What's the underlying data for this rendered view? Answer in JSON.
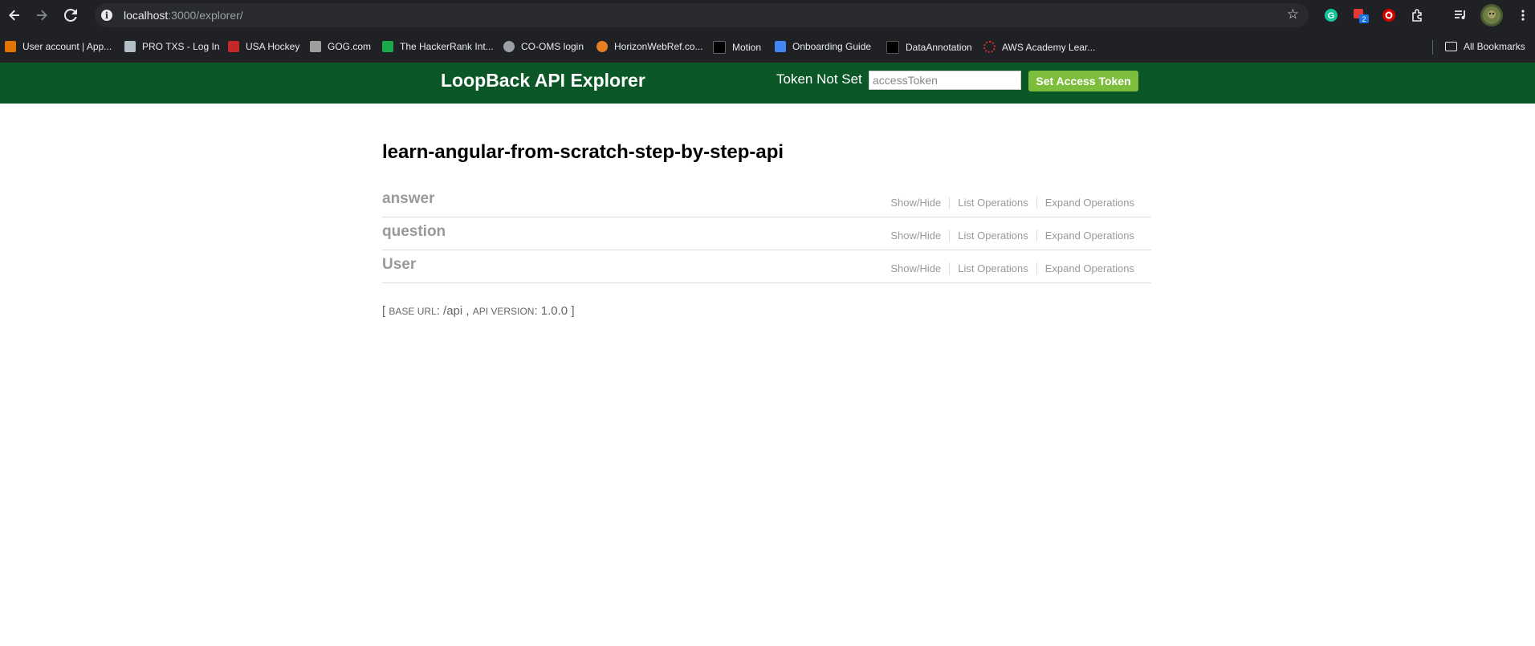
{
  "browser": {
    "url_host": "localhost",
    "url_rest": ":3000/explorer/",
    "extension_badge": "2",
    "all_bookmarks_label": "All Bookmarks",
    "bookmarks": [
      {
        "label": "User account | App...",
        "color": "#e37400"
      },
      {
        "label": "PRO TXS - Log In",
        "color": "#b0bec5"
      },
      {
        "label": "USA Hockey",
        "color": "#c62828"
      },
      {
        "label": "GOG.com",
        "color": "#9e9e9e"
      },
      {
        "label": "The HackerRank Int...",
        "color": "#1ba94c"
      },
      {
        "label": "CO-OMS login",
        "color": "#9aa0a6"
      },
      {
        "label": "HorizonWebRef.co...",
        "color": "#e67e22"
      },
      {
        "label": "Motion",
        "color": "#000000"
      },
      {
        "label": "Onboarding Guide",
        "color": "#4285f4"
      },
      {
        "label": "DataAnnotation",
        "color": "#000000"
      },
      {
        "label": "AWS Academy Lear...",
        "color": "#d32f2f"
      }
    ]
  },
  "header": {
    "title": "LoopBack API Explorer",
    "token_status": "Token Not Set",
    "token_placeholder": "accessToken",
    "set_button_label": "Set Access Token"
  },
  "main": {
    "api_title": "learn-angular-from-scratch-step-by-step-api",
    "resources": [
      {
        "name": "answer",
        "show_hide": "Show/Hide",
        "list_ops": "List Operations",
        "expand_ops": "Expand Operations"
      },
      {
        "name": "question",
        "show_hide": "Show/Hide",
        "list_ops": "List Operations",
        "expand_ops": "Expand Operations"
      },
      {
        "name": "User",
        "show_hide": "Show/Hide",
        "list_ops": "List Operations",
        "expand_ops": "Expand Operations"
      }
    ],
    "base_url_label": "Base URL",
    "base_url_value": "/api",
    "api_version_label": "API Version",
    "api_version_value": "1.0.0"
  },
  "colors": {
    "header_bg": "#0b5727",
    "button_bg": "#7cbd3c",
    "resource_text": "#999999"
  }
}
